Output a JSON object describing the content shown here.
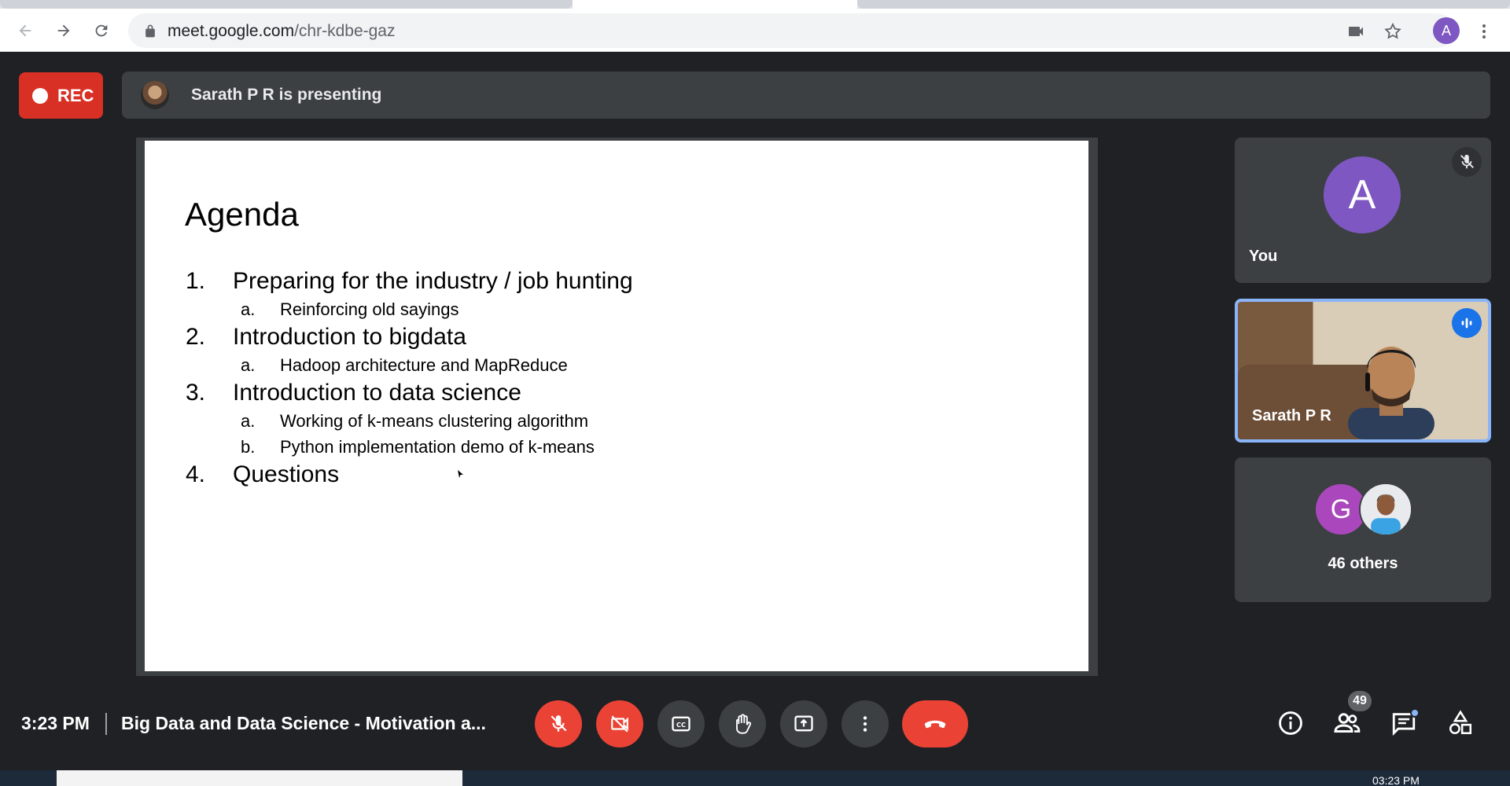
{
  "browser": {
    "url_host": "meet.google.com",
    "url_path": "/chr-kdbe-gaz",
    "profile_initial": "A"
  },
  "topbar": {
    "rec_label": "REC",
    "presenting_text": "Sarath P R is presenting"
  },
  "slide": {
    "title": "Agenda",
    "items": [
      {
        "num": "1.",
        "text": "Preparing for the industry / job hunting"
      },
      {
        "num": "a.",
        "text": "Reinforcing old sayings"
      },
      {
        "num": "2.",
        "text": "Introduction to bigdata"
      },
      {
        "num": "a.",
        "text": "Hadoop architecture and MapReduce"
      },
      {
        "num": "3.",
        "text": "Introduction to data science"
      },
      {
        "num": "a.",
        "text": "Working of k-means clustering algorithm"
      },
      {
        "num": "b.",
        "text": "Python implementation demo of k-means"
      },
      {
        "num": "4.",
        "text": "Questions"
      }
    ]
  },
  "participants": {
    "you": {
      "initial": "A",
      "name": "You",
      "avatar_color": "#7e57c2"
    },
    "presenter": {
      "name": "Sarath P R"
    },
    "others": {
      "initial": "G",
      "label": "46 others",
      "avatar_color": "#ab47bc"
    }
  },
  "bottombar": {
    "time": "3:23 PM",
    "meeting_title": "Big Data and Data Science - Motivation a...",
    "people_count": "49"
  },
  "taskbar": {
    "clock": "03:23 PM"
  },
  "colors": {
    "accent_red": "#ea4335",
    "accent_blue": "#1a73e8",
    "tile_bg": "#3c4043",
    "page_bg": "#202124"
  }
}
